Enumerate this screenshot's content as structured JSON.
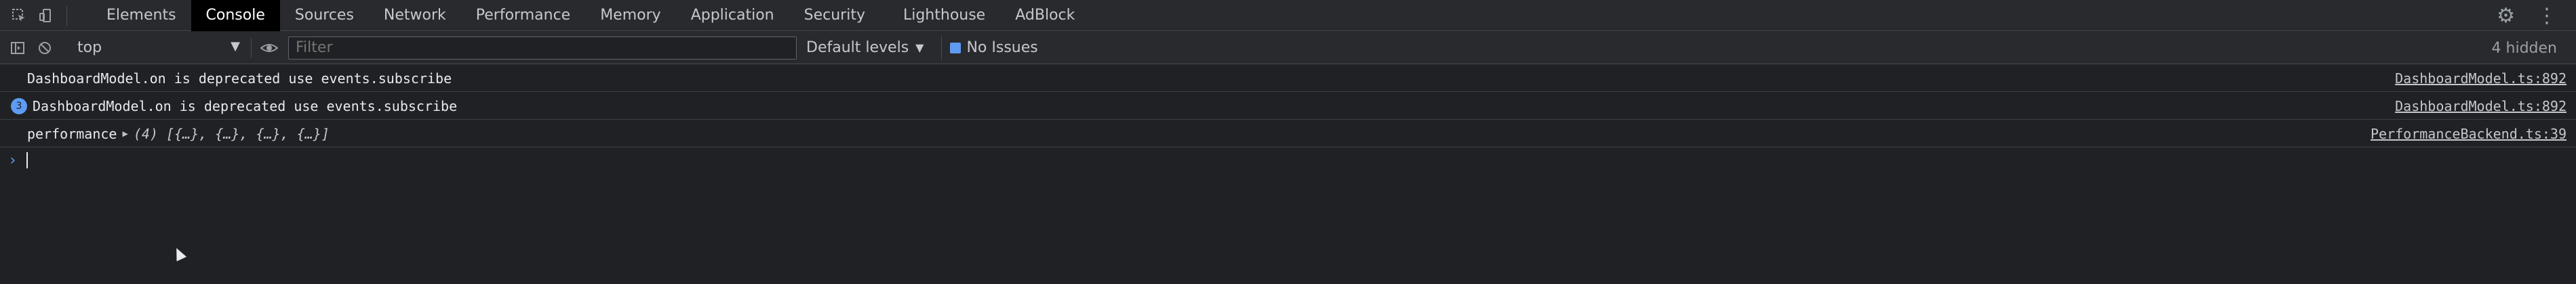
{
  "tabs": [
    "Elements",
    "Console",
    "Sources",
    "Network",
    "Performance",
    "Memory",
    "Application",
    "Security",
    "Lighthouse",
    "AdBlock"
  ],
  "active_tab": "Console",
  "toolbar": {
    "context": "top",
    "filter_placeholder": "Filter",
    "levels": "Default levels",
    "issues": "No Issues",
    "hidden": "4 hidden"
  },
  "messages": [
    {
      "text": "DashboardModel.on is deprecated use events.subscribe",
      "source": "DashboardModel.ts:892",
      "badge": ""
    },
    {
      "text": "DashboardModel.on is deprecated use events.subscribe",
      "source": "DashboardModel.ts:892",
      "badge": "3"
    },
    {
      "label": "performance",
      "preview": "(4) [{…}, {…}, {…}, {…}]",
      "source": "PerformanceBackend.ts:39"
    }
  ],
  "icons": [
    "inspect-icon",
    "device-toggle-icon",
    "sidebar-toggle-icon",
    "clear-console-icon",
    "eye-icon",
    "gear-icon",
    "kebab-menu-icon"
  ],
  "colors": {
    "background": "#202124",
    "toolbar": "#292a2d",
    "accent": "#5e9bf3"
  }
}
